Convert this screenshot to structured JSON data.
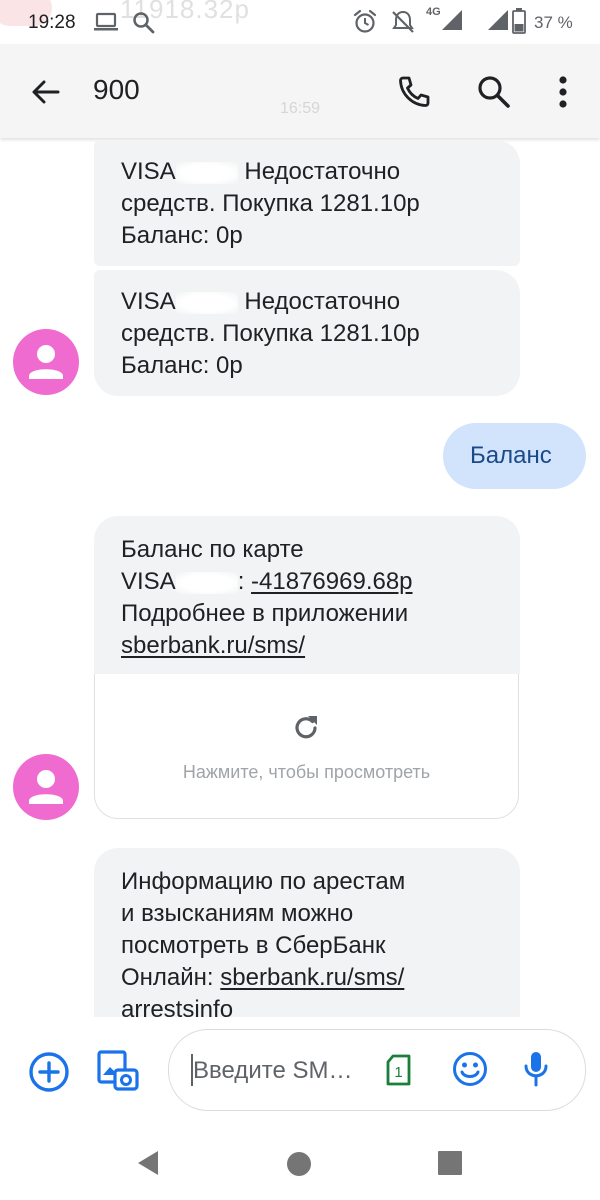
{
  "status_bar": {
    "time": "19:28",
    "background_notification_amount": "11918.32р",
    "network": "4G",
    "battery_percent": "37 %",
    "icons": [
      "laptop-icon",
      "search-icon",
      "alarm-icon",
      "do-not-disturb-icon",
      "signal-icon",
      "battery-icon"
    ]
  },
  "app_bar": {
    "title": "900",
    "background_time": "16:59",
    "icons": [
      "back-arrow-icon",
      "phone-icon",
      "search-icon",
      "more-vert-icon"
    ]
  },
  "messages": [
    {
      "direction": "incoming",
      "text_before_mask": "VISA",
      "text_after_mask": " Недостаточно",
      "line2": "средств. Покупка 1281.10р",
      "line3": "Баланс: 0р"
    },
    {
      "direction": "incoming",
      "text_before_mask": "VISA",
      "text_after_mask": " Недостаточно",
      "line2": "средств. Покупка 1281.10р",
      "line3": "Баланс: 0р"
    },
    {
      "direction": "outgoing",
      "text": "Баланс"
    },
    {
      "direction": "incoming",
      "line1": "Баланс по карте",
      "card_label": "VISA",
      "card_sep": ": ",
      "balance": "-41876969.68р",
      "line3": "Подробнее в приложении",
      "link": "sberbank.ru/sms/",
      "preview_hint": "Нажмите, чтобы просмотреть"
    },
    {
      "direction": "incoming",
      "line1": "Информацию по арестам",
      "line2": "и взысканиям можно",
      "line3": "посмотреть в СберБанк",
      "line4_prefix": "Онлайн: ",
      "link": "sberbank.ru/sms/",
      "line5": "arrestsinfo"
    }
  ],
  "compose": {
    "placeholder": "Введите SM…",
    "sim_label": "1"
  },
  "colors": {
    "accent_blue": "#1a73e8",
    "avatar_pink": "#f06bd0",
    "incoming_bubble": "#f1f3f4",
    "outgoing_bubble": "#d2e3fc",
    "sim_green": "#188038"
  }
}
